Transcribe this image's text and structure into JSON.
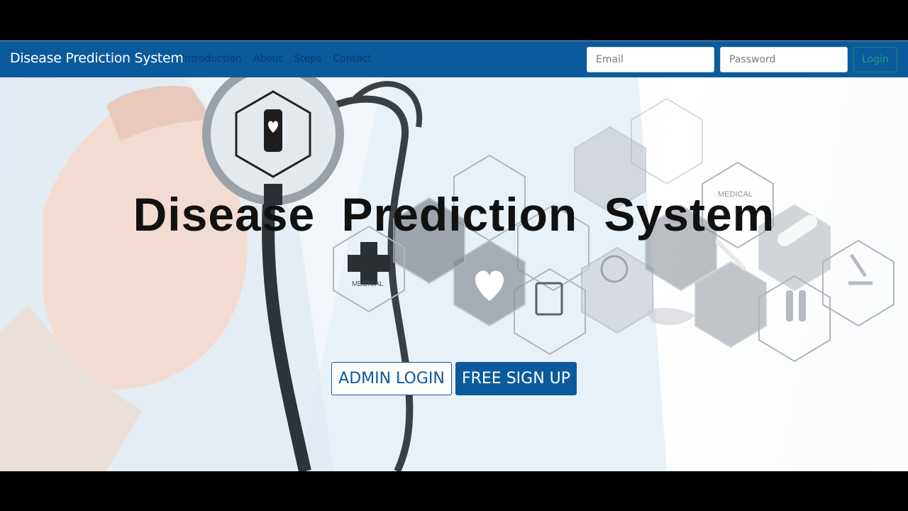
{
  "navbar": {
    "brand": "Disease Prediction System",
    "links": [
      {
        "label": "Introduction"
      },
      {
        "label": "About"
      },
      {
        "label": "Steps"
      },
      {
        "label": "Contact"
      }
    ],
    "email_placeholder": "Email",
    "password_placeholder": "Password",
    "login_label": "Login",
    "colors": {
      "bar": "#0b5a9c",
      "link": "#0a3d6e",
      "login_text": "#1aa07c"
    }
  },
  "hero": {
    "title": "Disease Prediction System",
    "admin_label": "ADMIN LOGIN",
    "signup_label": "FREE SIGN UP",
    "hex_icon_labels": [
      "MEDICAL",
      "MEDICAL"
    ]
  }
}
